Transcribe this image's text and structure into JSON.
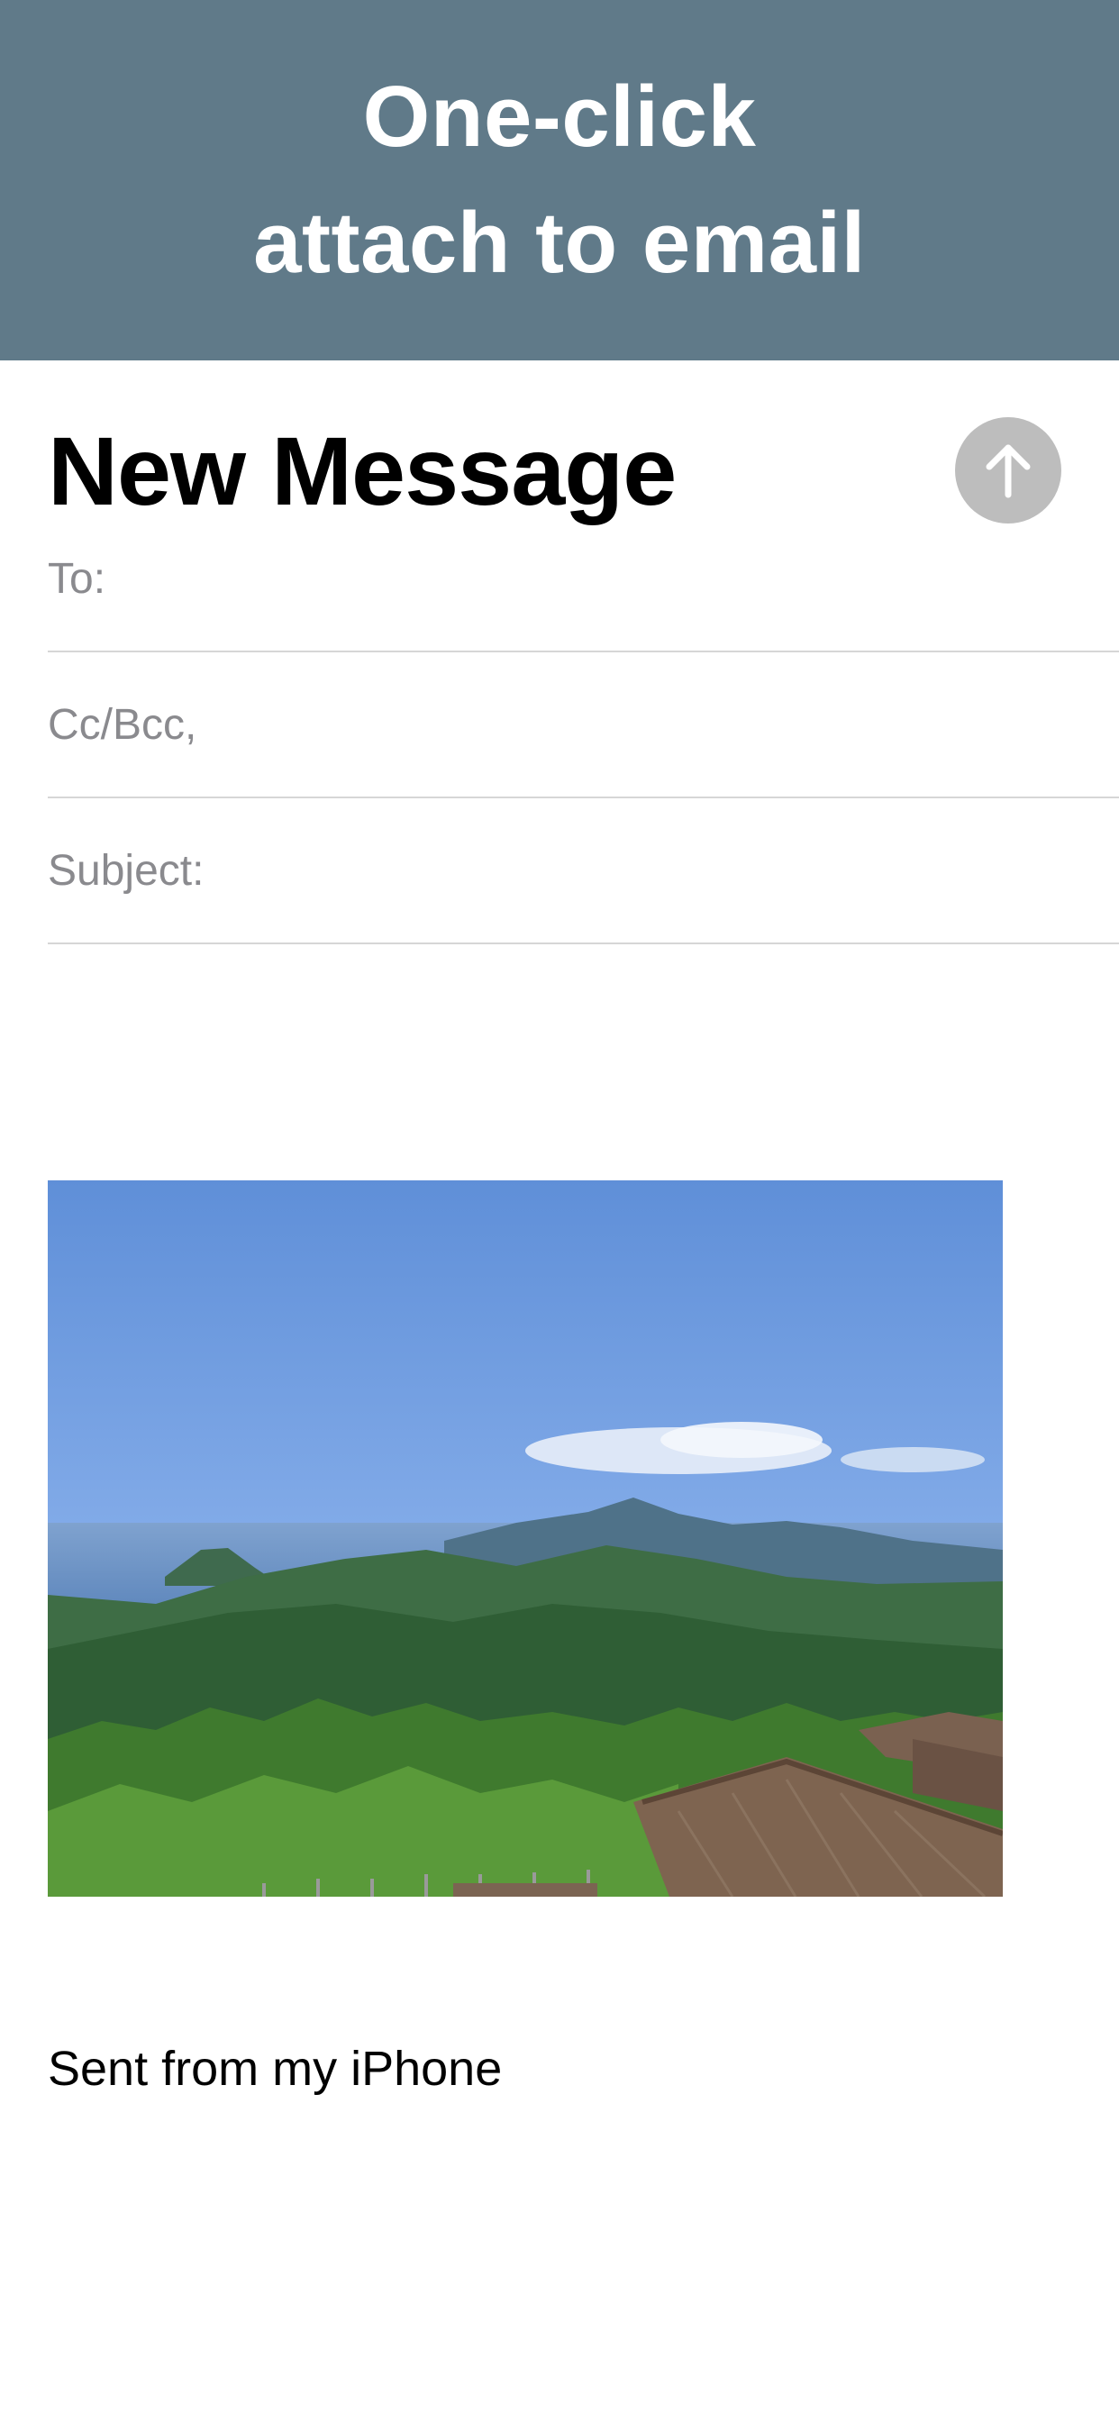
{
  "banner": {
    "line1": "One-click",
    "line2": "attach to email"
  },
  "compose": {
    "title": "New Message",
    "send_icon": "arrow-up-icon",
    "fields": {
      "to_label": "To:",
      "cc_bcc_label": "Cc/Bcc,",
      "subject_label": "Subject:"
    },
    "attachment": {
      "description_icon": "landscape-photo"
    },
    "signature": "Sent from my iPhone"
  },
  "colors": {
    "banner_bg": "#607a89",
    "send_button_bg": "#bdbdbd",
    "field_label": "#8a8a8e",
    "divider": "#d6d6d6"
  }
}
